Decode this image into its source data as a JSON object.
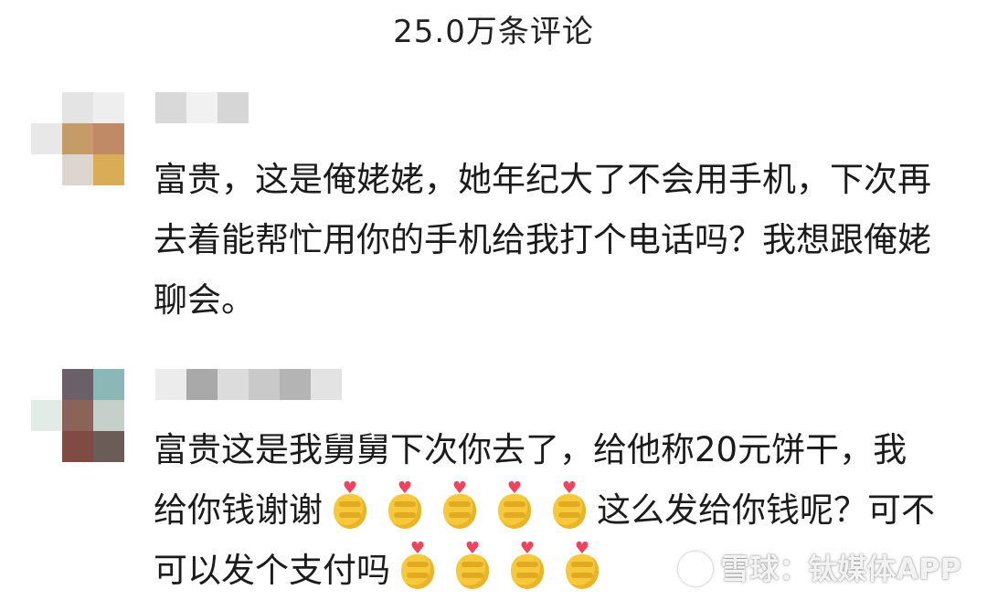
{
  "header": {
    "title": "25.0万条评论"
  },
  "comments": [
    {
      "text_parts": [
        "富贵，这是俺姥姥，她年纪大了不会用手机，下次再去着能帮忙用你的手机给我打个电话吗？我想跟俺姥聊会。"
      ],
      "emoji_name": null
    },
    {
      "text_parts": [
        "富贵这是我舅舅下次你去了，给他称20元饼干，我给你钱谢谢",
        "这么发给你钱呢？可不可以发个支付吗"
      ],
      "emoji_name": "finger-heart-emoji"
    }
  ],
  "watermark": {
    "text": "雪球：钛媒体APP"
  },
  "colors": {
    "heart": "#f0435e",
    "emoji_hand": "#f6c83a",
    "text": "#1b1b1b"
  },
  "icons": {
    "reaction": "finger-heart-emoji",
    "brand": "xueqiu-logo-icon"
  }
}
